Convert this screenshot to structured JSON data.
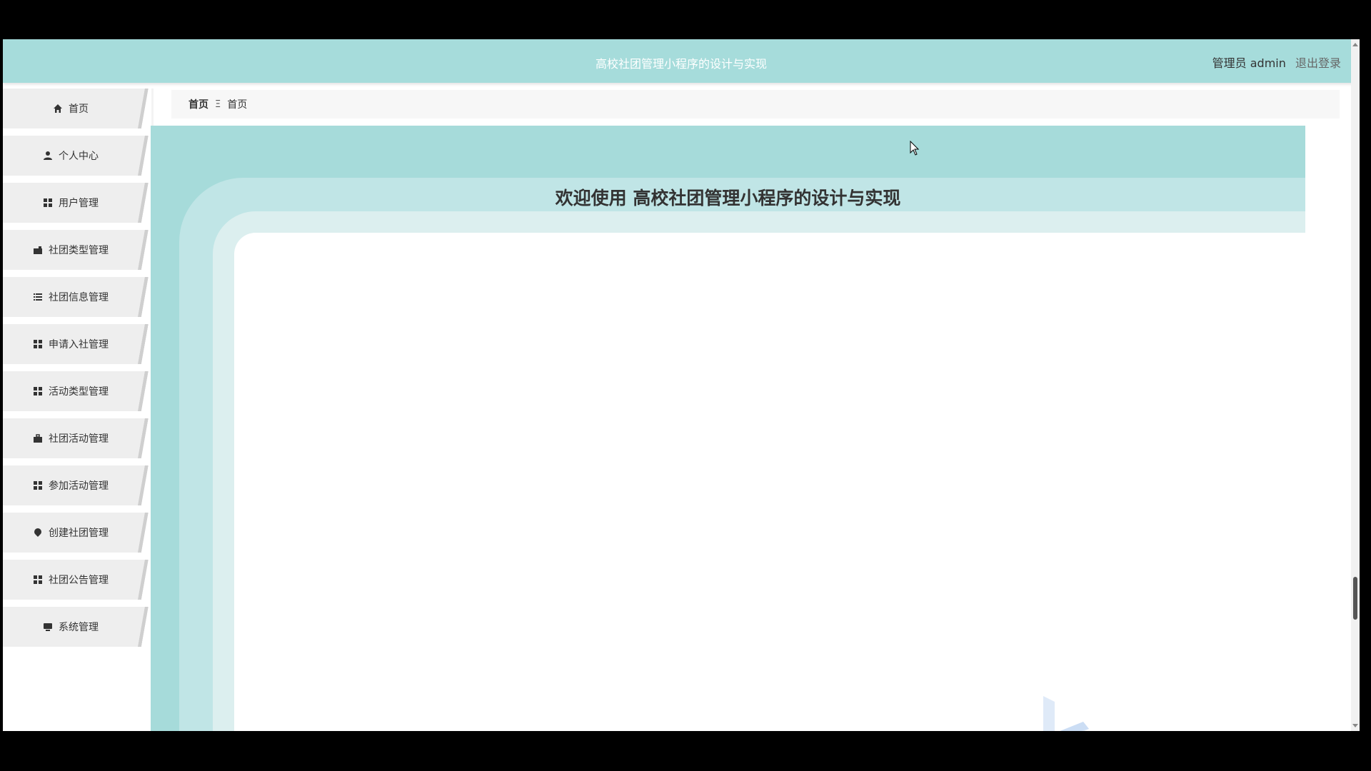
{
  "header": {
    "title": "高校社团管理小程序的设计与实现",
    "user_label": "管理员 admin",
    "logout_label": "退出登录"
  },
  "sidebar": {
    "items": [
      {
        "label": "首页",
        "icon": "home-icon"
      },
      {
        "label": "个人中心",
        "icon": "user-icon"
      },
      {
        "label": "用户管理",
        "icon": "grid-icon"
      },
      {
        "label": "社团类型管理",
        "icon": "briefcase-icon"
      },
      {
        "label": "社团信息管理",
        "icon": "list-icon"
      },
      {
        "label": "申请入社管理",
        "icon": "grid-icon"
      },
      {
        "label": "活动类型管理",
        "icon": "grid-icon"
      },
      {
        "label": "社团活动管理",
        "icon": "briefcase-icon"
      },
      {
        "label": "参加活动管理",
        "icon": "grid-icon"
      },
      {
        "label": "创建社团管理",
        "icon": "pin-icon"
      },
      {
        "label": "社团公告管理",
        "icon": "grid-icon"
      },
      {
        "label": "系统管理",
        "icon": "monitor-icon"
      }
    ]
  },
  "breadcrumb": {
    "first": "首页",
    "separator": "Ξ",
    "current": "首页"
  },
  "main": {
    "welcome": "欢迎使用 高校社团管理小程序的设计与实现"
  },
  "colors": {
    "accent": "#a6dcdb",
    "band_mid": "#c0e5e6",
    "band_light": "#dcefef"
  }
}
